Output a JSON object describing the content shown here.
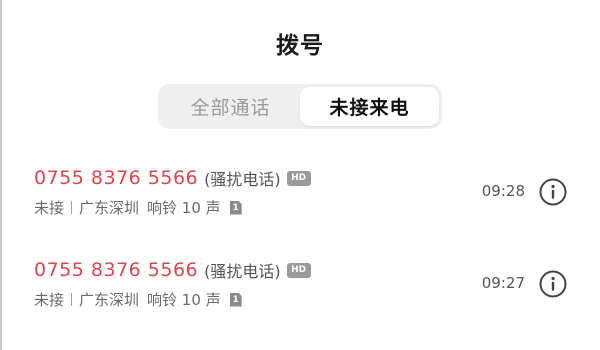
{
  "header": {
    "title": "拨号"
  },
  "tabs": [
    {
      "label": "全部通话",
      "active": false
    },
    {
      "label": "未接来电",
      "active": true
    }
  ],
  "calls": [
    {
      "number": "0755 8376 5566",
      "tag": "(骚扰电话)",
      "hd": "HD",
      "status": "未接",
      "location": "广东深圳",
      "ring": "响铃 10 声",
      "sim": "1",
      "time": "09:28",
      "info_icon": "info-circle-icon"
    },
    {
      "number": "0755 8376 5566",
      "tag": "(骚扰电话)",
      "hd": "HD",
      "status": "未接",
      "location": "广东深圳",
      "ring": "响铃 10 声",
      "sim": "1",
      "time": "09:27",
      "info_icon": "info-circle-icon"
    }
  ],
  "colors": {
    "missed_number": "#e0454b",
    "segmented_bg": "#efefef",
    "badge_gray": "#9a9a9a"
  }
}
